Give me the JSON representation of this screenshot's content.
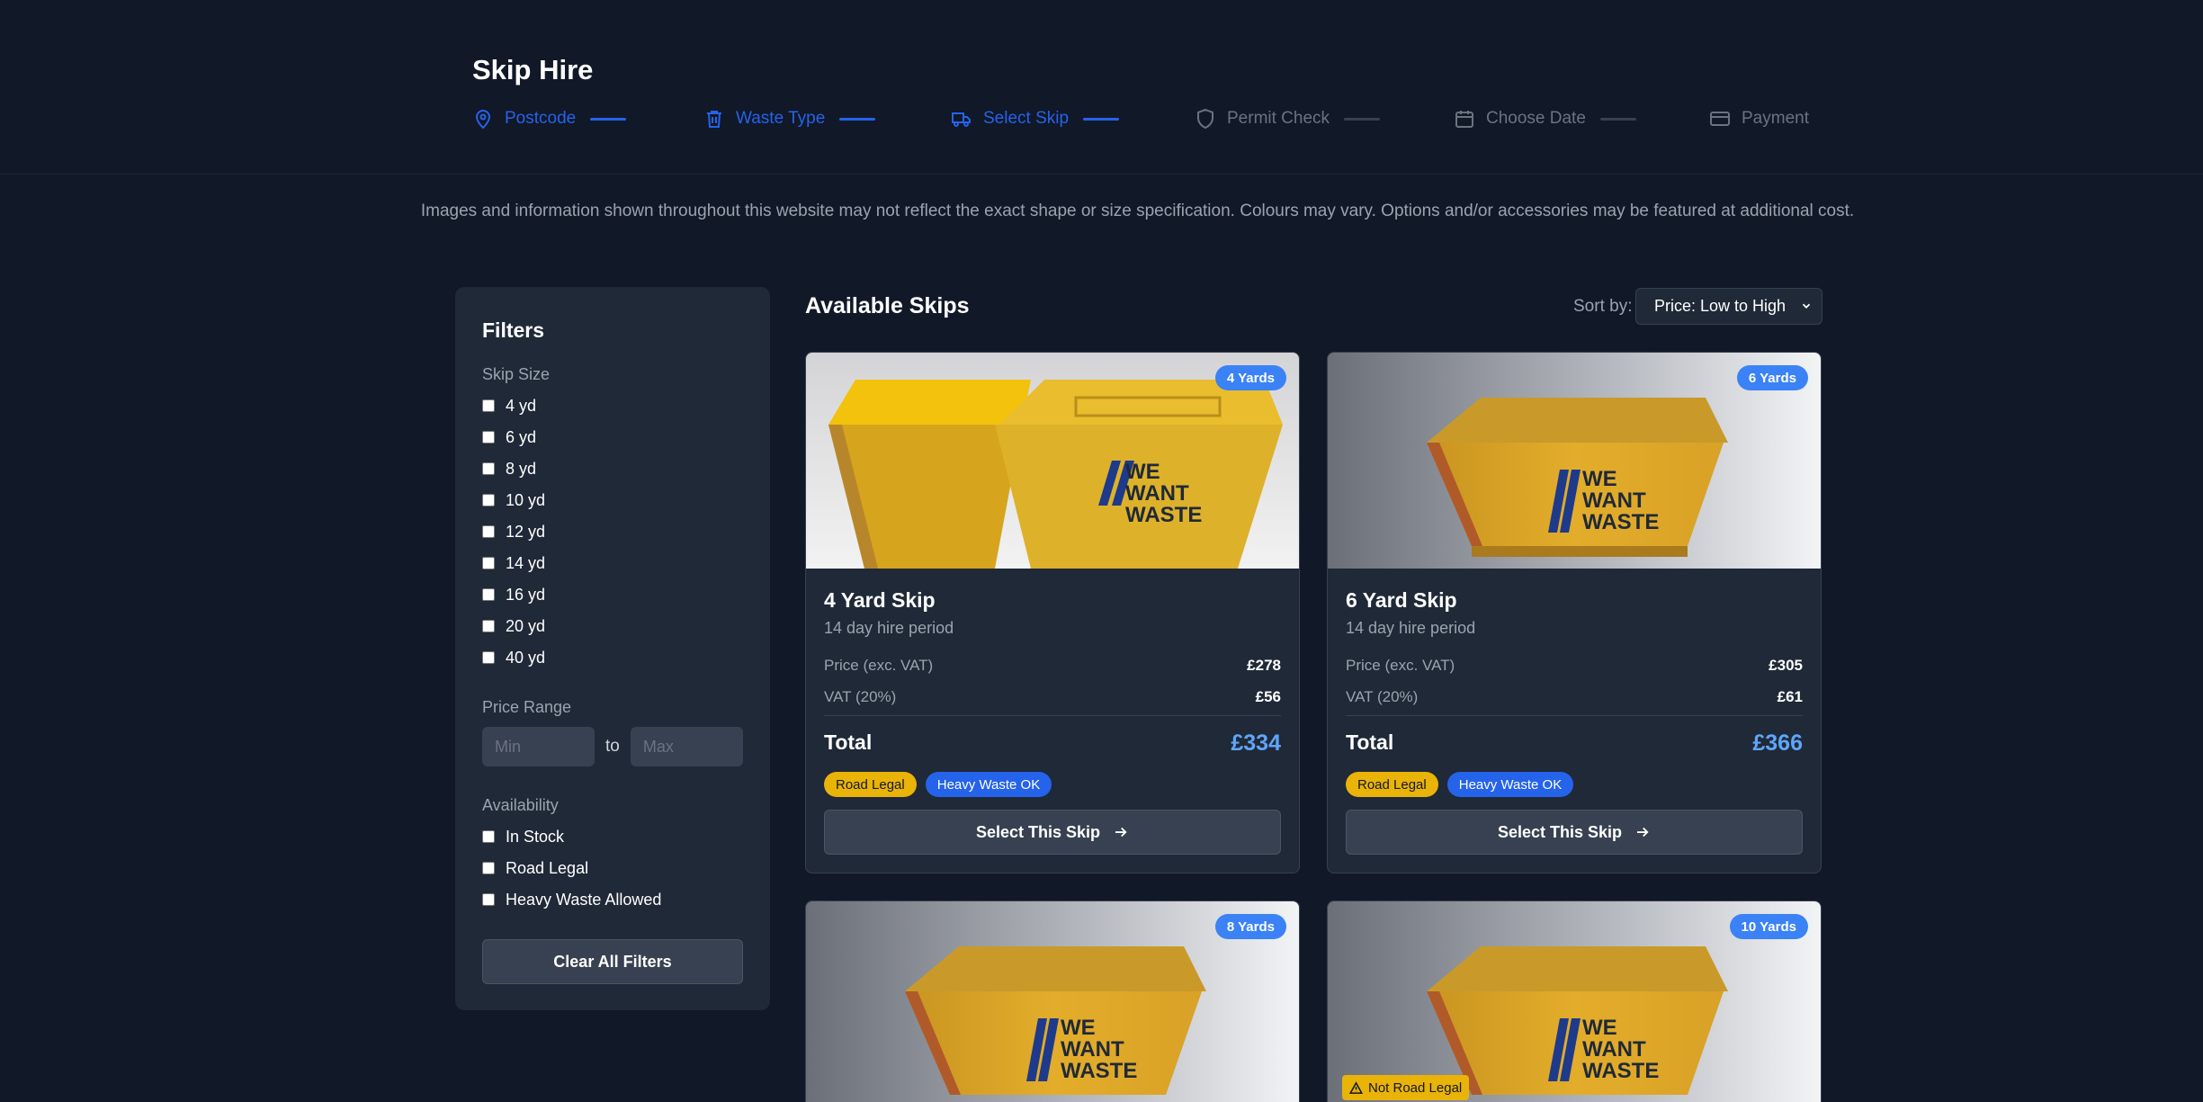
{
  "header": {
    "title": "Skip Hire",
    "steps": [
      {
        "label": "Postcode",
        "icon": "map-pin-icon",
        "state": "active"
      },
      {
        "label": "Waste Type",
        "icon": "trash-icon",
        "state": "active"
      },
      {
        "label": "Select Skip",
        "icon": "truck-icon",
        "state": "active"
      },
      {
        "label": "Permit Check",
        "icon": "shield-icon",
        "state": "inactive"
      },
      {
        "label": "Choose Date",
        "icon": "calendar-icon",
        "state": "inactive"
      },
      {
        "label": "Payment",
        "icon": "credit-card-icon",
        "state": "inactive"
      }
    ]
  },
  "disclaimer": "Images and information shown throughout this website may not reflect the exact shape or size specification. Colours may vary. Options and/or accessories may be featured at additional cost.",
  "filters": {
    "title": "Filters",
    "skip_size_label": "Skip Size",
    "sizes": [
      "4 yd",
      "6 yd",
      "8 yd",
      "10 yd",
      "12 yd",
      "14 yd",
      "16 yd",
      "20 yd",
      "40 yd"
    ],
    "price_range_label": "Price Range",
    "min_placeholder": "Min",
    "to_label": "to",
    "max_placeholder": "Max",
    "availability_label": "Availability",
    "availability": [
      "In Stock",
      "Road Legal",
      "Heavy Waste Allowed"
    ],
    "clear_label": "Clear All Filters"
  },
  "main": {
    "title": "Available Skips",
    "sort_label": "Sort by:",
    "sort_value": "Price: Low to High"
  },
  "skips": [
    {
      "badge": "4 Yards",
      "name": "4 Yard Skip",
      "period": "14 day hire period",
      "price_label": "Price (exc. VAT)",
      "price": "£278",
      "vat_label": "VAT (20%)",
      "vat": "£56",
      "total_label": "Total",
      "total": "£334",
      "tags": [
        "Road Legal",
        "Heavy Waste OK"
      ],
      "button": "Select This Skip"
    },
    {
      "badge": "6 Yards",
      "name": "6 Yard Skip",
      "period": "14 day hire period",
      "price_label": "Price (exc. VAT)",
      "price": "£305",
      "vat_label": "VAT (20%)",
      "vat": "£61",
      "total_label": "Total",
      "total": "£366",
      "tags": [
        "Road Legal",
        "Heavy Waste OK"
      ],
      "button": "Select This Skip"
    },
    {
      "badge": "8 Yards"
    },
    {
      "badge": "10 Yards",
      "warning": "Not Road Legal"
    }
  ],
  "brand_logo_text": "WE WANT WASTE",
  "colors": {
    "background": "#111827",
    "panel": "#1f2937",
    "accent": "#2563eb",
    "total": "#60a5fa",
    "road_legal": "#eab308",
    "skip_yellow": "#e5b52b"
  }
}
